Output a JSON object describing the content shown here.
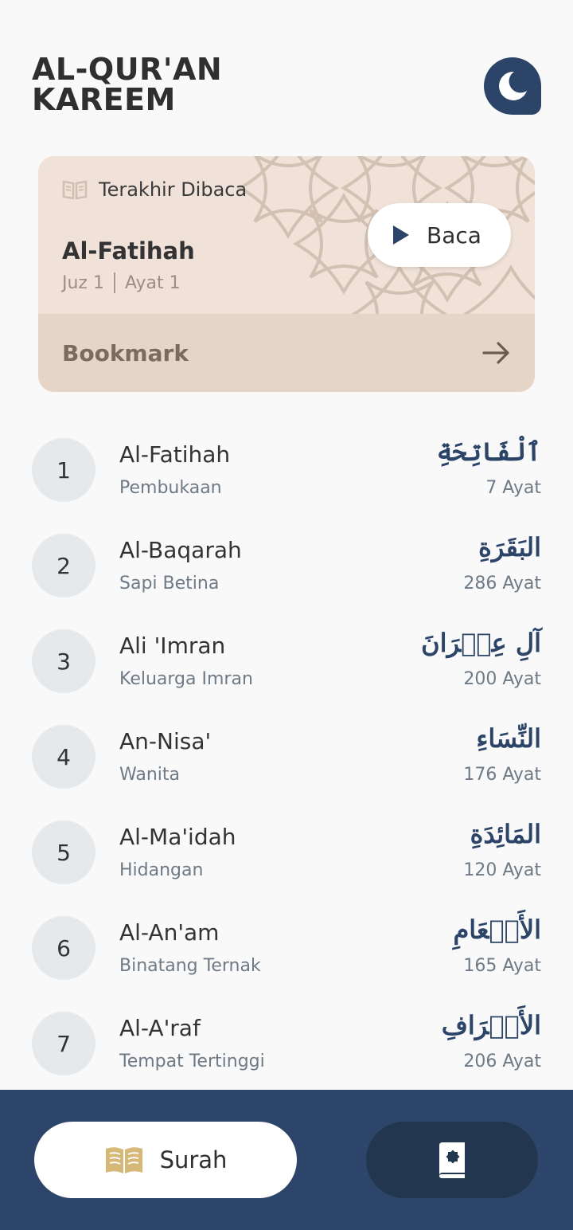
{
  "header": {
    "title": "AL-QUR'AN\nKAREEM",
    "theme_icon": "moon-icon"
  },
  "last_read": {
    "label": "Terakhir Dibaca",
    "surah": "Al-Fatihah",
    "juz": "Juz 1",
    "ayat": "Ayat 1",
    "read_button": "Baca",
    "bookmark_label": "Bookmark"
  },
  "surahs": [
    {
      "number": "1",
      "name": "Al-Fatihah",
      "meaning": "Pembukaan",
      "arabic": "ٱلْفَاتِحَةِ",
      "ayat": "7 Ayat"
    },
    {
      "number": "2",
      "name": "Al-Baqarah",
      "meaning": "Sapi Betina",
      "arabic": "البَقَرَةِ",
      "ayat": "286 Ayat"
    },
    {
      "number": "3",
      "name": "Ali 'Imran",
      "meaning": "Keluarga Imran",
      "arabic": "آلِ عِمۡرَانَ",
      "ayat": "200 Ayat"
    },
    {
      "number": "4",
      "name": "An-Nisa'",
      "meaning": "Wanita",
      "arabic": "النِّسَاءِ",
      "ayat": "176 Ayat"
    },
    {
      "number": "5",
      "name": "Al-Ma'idah",
      "meaning": "Hidangan",
      "arabic": "المَائِدَةِ",
      "ayat": "120 Ayat"
    },
    {
      "number": "6",
      "name": "Al-An'am",
      "meaning": "Binatang Ternak",
      "arabic": "الأَنۡعَامِ",
      "ayat": "165 Ayat"
    },
    {
      "number": "7",
      "name": "Al-A'raf",
      "meaning": "Tempat Tertinggi",
      "arabic": "الأَعۡرَافِ",
      "ayat": "206 Ayat"
    }
  ],
  "bottom_nav": {
    "surah_label": "Surah",
    "surah_icon": "open-book-icon",
    "juz_icon": "quran-book-icon"
  },
  "colors": {
    "primary": "#2d456a",
    "card": "#f0e2d8",
    "card_bottom": "#e5d4c8",
    "accent_gold": "#d6b878"
  }
}
